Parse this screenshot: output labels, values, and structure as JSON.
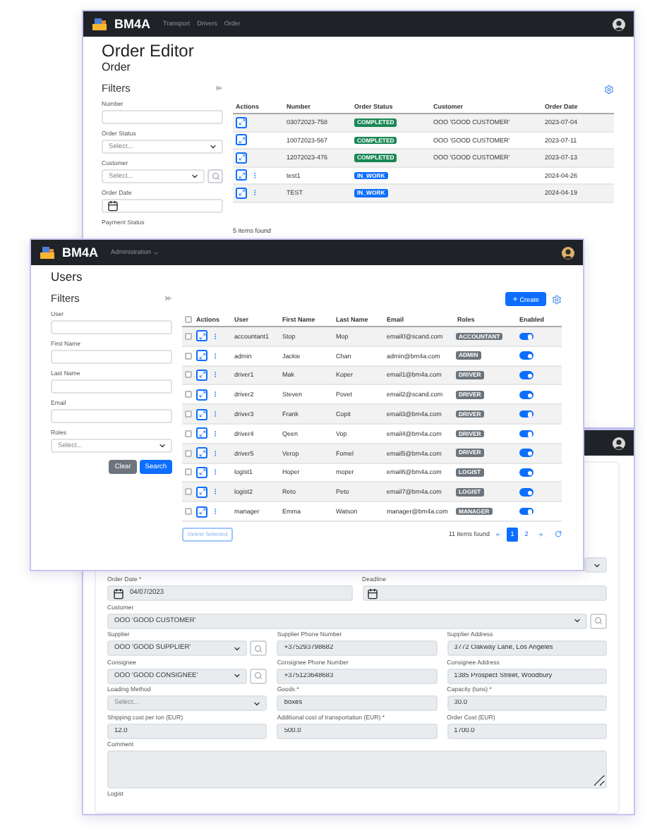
{
  "order_list_window": {
    "navbar": {
      "brand": "BM4A",
      "links": [
        "Transport",
        "Drivers",
        "Order"
      ]
    },
    "title": "Order Editor",
    "subtitle": "Order",
    "filters": {
      "title": "Filters",
      "fields": [
        {
          "label": "Number",
          "kind": "text"
        },
        {
          "label": "Order Status",
          "kind": "select",
          "placeholder": "Select..."
        },
        {
          "label": "Customer",
          "kind": "select_search",
          "placeholder": "Select..."
        },
        {
          "label": "Order Date",
          "kind": "date"
        },
        {
          "label": "Payment Status",
          "kind": "label_only"
        }
      ]
    },
    "table": {
      "columns": [
        "Actions",
        "Number",
        "Order Status",
        "Customer",
        "Order Date"
      ],
      "rows": [
        {
          "number": "03072023-758",
          "status": "COMPLETED",
          "color": "#198754",
          "customer": "OOO 'GOOD CUSTOMER'",
          "date": "2023-07-04",
          "has_menu": false
        },
        {
          "number": "10072023-567",
          "status": "COMPLETED",
          "color": "#198754",
          "customer": "OOO 'GOOD CUSTOMER'",
          "date": "2023-07-11",
          "has_menu": false
        },
        {
          "number": "12072023-476",
          "status": "COMPLETED",
          "color": "#198754",
          "customer": "OOO 'GOOD CUSTOMER'",
          "date": "2023-07-13",
          "has_menu": false
        },
        {
          "number": "test1",
          "status": "IN_WORK",
          "color": "#0d6efd",
          "date": "2024-04-26",
          "has_menu": true
        },
        {
          "number": "TEST",
          "status": "IN_WORK",
          "color": "#0d6efd",
          "date": "2024-04-19",
          "has_menu": true
        }
      ]
    },
    "count": "5 items found"
  },
  "users_window": {
    "navbar": {
      "brand": "BM4A",
      "menu": "Administration"
    },
    "title": "Users",
    "filters": {
      "title": "Filters",
      "fields": [
        {
          "label": "User",
          "kind": "text"
        },
        {
          "label": "First Name",
          "kind": "text"
        },
        {
          "label": "Last Name",
          "kind": "text"
        },
        {
          "label": "Email",
          "kind": "text"
        },
        {
          "label": "Roles",
          "kind": "select",
          "placeholder": "Select..."
        }
      ],
      "buttons": [
        {
          "label": "Clear",
          "kind": "secondary"
        },
        {
          "label": "Search",
          "kind": "primary"
        }
      ]
    },
    "create_button": "Create",
    "table": {
      "select_all_checked": false,
      "columns": [
        "Actions",
        "User",
        "First Name",
        "Last Name",
        "Email",
        "Roles",
        "Enabled"
      ],
      "rows": [
        {
          "checked": false,
          "user": "accountant1",
          "first_name": "Stop",
          "last_name": "Mop",
          "email": "email0@scand.com",
          "role": "ACCOUNTANT",
          "enabled": true
        },
        {
          "checked": false,
          "user": "admin",
          "first_name": "Jackie",
          "last_name": "Chan",
          "email": "admin@bm4a.com",
          "role": "ADMIN",
          "enabled": true
        },
        {
          "checked": false,
          "user": "driver1",
          "first_name": "Mak",
          "last_name": "Koper",
          "email": "email1@bm4a.com",
          "role": "DRIVER",
          "enabled": true
        },
        {
          "checked": false,
          "user": "driver2",
          "first_name": "Steven",
          "last_name": "Povet",
          "email": "email2@scand.com",
          "role": "DRIVER",
          "enabled": true
        },
        {
          "checked": false,
          "user": "driver3",
          "first_name": "Frank",
          "last_name": "Copit",
          "email": "email3@bm4a.com",
          "role": "DRIVER",
          "enabled": true
        },
        {
          "checked": false,
          "user": "driver4",
          "first_name": "Qeen",
          "last_name": "Vop",
          "email": "email4@bm4a.com",
          "role": "DRIVER",
          "enabled": true
        },
        {
          "checked": false,
          "user": "driver5",
          "first_name": "Verop",
          "last_name": "Fomel",
          "email": "email5@bm4a.com",
          "role": "DRIVER",
          "enabled": true
        },
        {
          "checked": false,
          "user": "logist1",
          "first_name": "Hoper",
          "last_name": "moper",
          "email": "email6@bm4a.com",
          "role": "LOGIST",
          "enabled": true
        },
        {
          "checked": false,
          "user": "logist2",
          "first_name": "Reto",
          "last_name": "Peto",
          "email": "email7@bm4a.com",
          "role": "LOGIST",
          "enabled": true
        },
        {
          "checked": false,
          "user": "manager",
          "first_name": "Emma",
          "last_name": "Watson",
          "email": "manager@bm4a.com",
          "role": "MANAGER",
          "enabled": true
        }
      ]
    },
    "delete_button": "Delete Selected",
    "count": "11 items found",
    "pages": [
      {
        "label": "1",
        "selected": true
      },
      {
        "label": "2",
        "selected": false
      }
    ]
  },
  "order_form_window": {
    "rows": [
      [
        {
          "label": "Order Date *",
          "kind": "date",
          "value": "04/07/2023"
        },
        {
          "label": "Deadline",
          "kind": "date"
        }
      ],
      [
        {
          "label": "Customer",
          "kind": "select_search",
          "value": "OOO 'GOOD CUSTOMER'"
        }
      ],
      [
        {
          "label": "Supplier",
          "kind": "select_search",
          "value": "OOO 'GOOD SUPPLIER'"
        },
        {
          "label": "Supplier Phone Number",
          "kind": "text",
          "value": "+375293798682"
        },
        {
          "label": "Supplier Address",
          "kind": "text",
          "value": "3772 Oakway Lane, Los Angeles"
        }
      ],
      [
        {
          "label": "Consignee",
          "kind": "select_search",
          "value": "OOO 'GOOD CONSIGNEE'"
        },
        {
          "label": "Consignee Phone Number",
          "kind": "text",
          "value": "+375123648683"
        },
        {
          "label": "Consignee Address",
          "kind": "text",
          "value": "1385 Prospect Street, Woodbury"
        }
      ],
      [
        {
          "label": "Loading Method",
          "kind": "select",
          "placeholder": "Select..."
        },
        {
          "label": "Goods *",
          "kind": "text",
          "value": "boxes"
        },
        {
          "label": "Capacity (tons) *",
          "kind": "text",
          "value": "30.0"
        }
      ],
      [
        {
          "label": "Shipping cost per ton (EUR)",
          "kind": "text",
          "value": "12.0"
        },
        {
          "label": "Additional cost of transportation (EUR) *",
          "kind": "text",
          "value": "500.0"
        },
        {
          "label": "Order Cost (EUR)",
          "kind": "text",
          "value": "1700.0"
        }
      ],
      [
        {
          "label": "Comment",
          "kind": "textarea"
        }
      ]
    ],
    "cut_label": "Logist"
  }
}
